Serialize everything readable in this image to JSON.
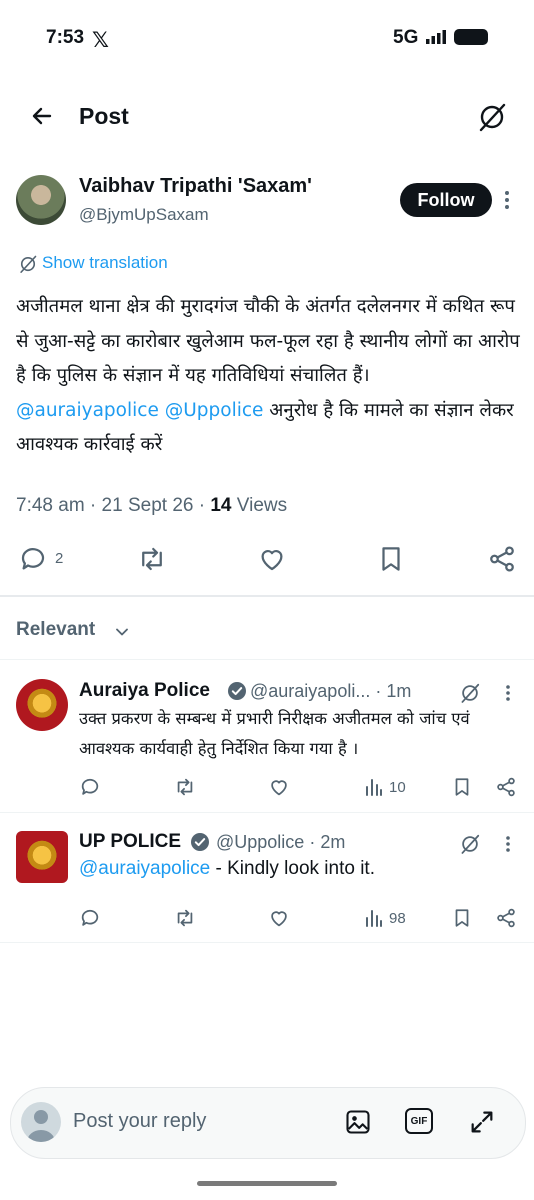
{
  "status": {
    "time": "7:53",
    "app_glyph": "𝕏",
    "network": "5G"
  },
  "header": {
    "title": "Post"
  },
  "post": {
    "author_name": "Vaibhav Tripathi 'Saxam'",
    "author_handle": "@BjymUpSaxam",
    "follow_label": "Follow",
    "translate_label": "Show translation",
    "body_line1": "अजीतमल थाना क्षेत्र की मुरादगंज चौकी के अंतर्गत दलेलनगर में कथित रूप से जुआ-सट्टे का कारोबार खुलेआम फल-फूल रहा है स्थानीय लोगों का आरोप है कि पुलिस के संज्ञान में यह गतिविधियां संचालित हैं।",
    "mention1": "@auraiyapolice",
    "mention2": "@Uppolice",
    "body_line2": "अनुरोध है कि मामले का संज्ञान लेकर आवश्यक कार्रवाई करें",
    "time": "7:48 am",
    "date": "21 Sept 26",
    "views_count": "14",
    "views_label": "Views",
    "reply_count": "2"
  },
  "relevant_label": "Relevant",
  "replies": [
    {
      "name": "Auraiya Police",
      "handle": "@auraiyapoli...",
      "time": "1m",
      "body": "उक्त प्रकरण के सम्बन्ध में प्रभारी निरीक्षक  अजीतमल को जांच एवं आवश्यक कार्यवाही हेतु निर्देशित किया गया है ।",
      "views": "10"
    },
    {
      "name": "UP POLICE",
      "handle": "@Uppolice",
      "time": "2m",
      "mention": "@auraiyapolice",
      "body": " - Kindly look into it.",
      "views": "98"
    }
  ],
  "compose": {
    "placeholder": "Post your reply"
  },
  "icons": {
    "verified": "verified-badge-icon",
    "grok": "grok-icon",
    "image": "image-icon",
    "gif": "gif-icon",
    "expand": "expand-icon",
    "gif_text": "GIF"
  },
  "colors": {
    "link": "#1d9bf0",
    "text": "#0f1419",
    "muted": "#536471",
    "verified": "#536471"
  }
}
